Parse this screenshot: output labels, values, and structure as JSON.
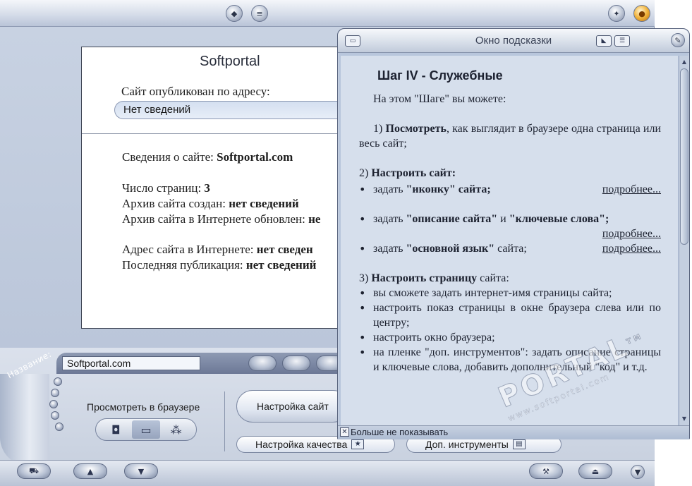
{
  "main": {
    "content_title": "Softportal",
    "published_label": "Сайт опубликован по адресу:",
    "published_value": "Нет сведений",
    "site_info_label": "Сведения о сайте: ",
    "site_info_value": "Softportal.com",
    "pages_label": "Число страниц: ",
    "pages_value": "3",
    "archive_created_label": "Архив сайта создан: ",
    "archive_created_value": "нет сведений",
    "archive_updated_label": "Архив сайта в Интернете обновлен: ",
    "archive_updated_value": "не",
    "address_label": "Адрес сайта в Интернете: ",
    "address_value": "нет сведен",
    "last_pub_label": "Последняя публикация: ",
    "last_pub_value": "нет сведений"
  },
  "bottom": {
    "name_label": "Название:",
    "name_value": "Softportal.com",
    "view_label": "Просмотреть в браузере",
    "settings_site": "Настройка сайт",
    "settings_quality": "Настройка качества",
    "tools": "Доп. инструменты"
  },
  "help": {
    "title": "Окно подсказки",
    "heading": "Шаг IV - Служебные",
    "intro": "На этом \"Шаге\" вы можете:",
    "p1_prefix": "1) ",
    "p1_bold": "Посмотреть",
    "p1_rest": ", как выглядит в браузере одна страница или весь сайт;",
    "p2_prefix": "2) ",
    "p2_bold": "Настроить сайт:",
    "b1_text": "задать ",
    "b1_bold": "\"иконку\" сайта;",
    "b1_link": "подробнее...",
    "b2_text": "задать ",
    "b2_bold1": "\"описание сайта\"",
    "b2_mid": " и ",
    "b2_bold2": "\"ключевые слова\";",
    "b2_link": "подробнее...",
    "b3_text": "задать ",
    "b3_bold": "\"основной язык\"",
    "b3_rest": " сайта;",
    "b3_link": "подробнее...",
    "p3_prefix": "3) ",
    "p3_bold": "Настроить страницу",
    "p3_rest": " сайта:",
    "c1": "вы сможете задать интернет-имя страницы сайта;",
    "c2": "настроить показ страницы в окне браузера слева или по центру;",
    "c3": "настроить окно браузера;",
    "c4": "на пленке \"доп. инструментов\": задать описание страницы и ключевые слова, добавить дополнительный \"код\" и т.д.",
    "dont_show": "Больше не показывать"
  },
  "watermark": {
    "main": "PORTAL",
    "tm": "TM",
    "sub": "www.softportal.com"
  },
  "colors": {
    "frame": "#c9d3e3",
    "help_body": "#d6dfec",
    "accent": "#f2b33b"
  }
}
